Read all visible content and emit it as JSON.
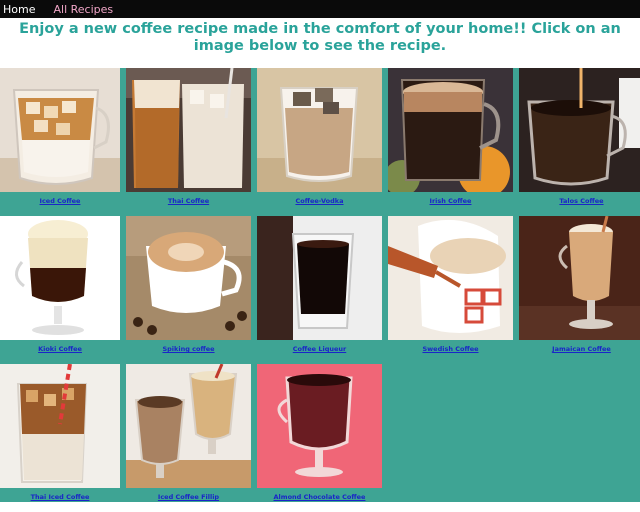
{
  "nav": {
    "home": "Home",
    "recipes": "All Recipes"
  },
  "headline": "Enjoy a new coffee recipe made in the comfort of your home!! Click on an image below to see the recipe.",
  "recipes": [
    {
      "label": "Iced Coffee",
      "icon": "iced-coffee-glass"
    },
    {
      "label": "Thai Coffee",
      "icon": "thai-coffee-glasses"
    },
    {
      "label": "Coffee-Vodka",
      "icon": "coffee-vodka-glass"
    },
    {
      "label": "Irish Coffee",
      "icon": "irish-coffee-mug"
    },
    {
      "label": "Talos Coffee",
      "icon": "talos-coffee-cup"
    },
    {
      "label": "Kioki Coffee",
      "icon": "kioki-coffee-goblet"
    },
    {
      "label": "Spiking coffee",
      "icon": "latte-cup"
    },
    {
      "label": "Coffee Liqueur",
      "icon": "liqueur-glass"
    },
    {
      "label": "Swedish Coffee",
      "icon": "swedish-coffee-pour"
    },
    {
      "label": "Jamaican Coffee",
      "icon": "jamaican-coffee-glass"
    },
    {
      "label": "Thai Iced Coffee",
      "icon": "thai-iced-coffee-jar"
    },
    {
      "label": "Iced Coffee Fillip",
      "icon": "iced-coffee-fillip-glasses"
    },
    {
      "label": "Almond Chocolate Coffee",
      "icon": "almond-chocolate-mug"
    }
  ],
  "colors": {
    "accent": "#2aa39a",
    "grid_bg": "#3ea494",
    "link": "#1a25c8",
    "nav_bg": "#0a0a0a",
    "nav_link_alt": "#f0a6c7"
  }
}
